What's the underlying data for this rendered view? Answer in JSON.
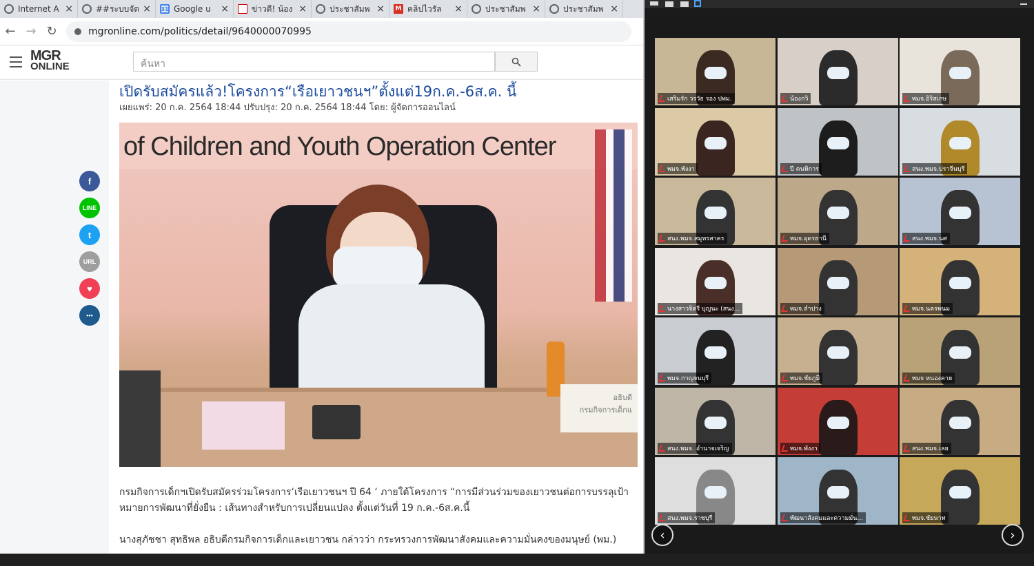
{
  "tabs": [
    {
      "title": "Internet A",
      "icon": "globe-icon"
    },
    {
      "title": "##ระบบจัด",
      "icon": "globe-icon"
    },
    {
      "title": "Google u",
      "icon": "google-calendar-icon"
    },
    {
      "title": "ข่าวดี! น้อง",
      "icon": "news-icon"
    },
    {
      "title": "ประชาสัมพ",
      "icon": "globe-icon"
    },
    {
      "title": "คลิปไวรัล",
      "icon": "mail-icon"
    },
    {
      "title": "ประชาสัมพ",
      "icon": "globe-icon"
    },
    {
      "title": "ประชาสัมพ",
      "icon": "globe-icon"
    }
  ],
  "address": {
    "url": "mgronline.com/politics/detail/9640000070995"
  },
  "site": {
    "logo_top": "MGR",
    "logo_bottom": "ONLINE",
    "search_placeholder": "ค้นหา"
  },
  "article": {
    "title": "เปิดรับสมัครแล้ว!โครงการ“เรือเยาวชนฯ”ตั้งแต่19ก.ค.-6ส.ค. นี้",
    "meta": "เผยแพร่: 20 ก.ค. 2564 18:44   ปรับปรุง: 20 ก.ค. 2564 18:44   โดย: ผู้จัดการออนไลน์",
    "photo_banner": "of Children and Youth Operation Center",
    "photo_nameplate_1": "อธิบดี",
    "photo_nameplate_2": "กรมกิจการเด็กแ",
    "para1": "กรมกิจการเด็กฯเปิดรับสมัครร่วมโครงการ‘เรือเยาวชนฯ ปี 64 ‘ ภายใต้โครงการ “การมีส่วนร่วมของเยาวชนต่อการบรรลุเป้าหมายการพัฒนาที่ยั่งยืน : เส้นทางสำหรับการเปลี่ยนแปลง ตั้งแต่วันที่ 19 ก.ค.-6ส.ค.นี้",
    "para2": "นางสุภัชชา สุทธิพล อธิบดีกรมกิจการเด็กและเยาวชน กล่าวว่า กระทรวงการพัฒนาสังคมและความมั่นคงของมนุษย์ (พม.)"
  },
  "share": [
    {
      "name": "facebook",
      "glyph": "f",
      "color": "#3b5998"
    },
    {
      "name": "line",
      "glyph": "LINE",
      "color": "#00c300"
    },
    {
      "name": "twitter",
      "glyph": "t",
      "color": "#1da1f2"
    },
    {
      "name": "url",
      "glyph": "URL",
      "color": "#9e9e9e"
    },
    {
      "name": "pocket",
      "glyph": "♥",
      "color": "#ef4056"
    },
    {
      "name": "comment",
      "glyph": "•••",
      "color": "#1e5b8c"
    }
  ],
  "zoom": {
    "tiles": [
      {
        "label": "เสริมรัก วรวัธ รอง ปพม.",
        "bg": "#c7b797",
        "fg": "#3b2a22"
      },
      {
        "label": "น้องกวิ",
        "bg": "#d8d0c8",
        "fg": "#2b2b2b"
      },
      {
        "label": "พมจ.อิริสเกษ",
        "bg": "#e8e4dc",
        "fg": "#7a6a5a"
      },
      {
        "label": "พมจ.พังงา",
        "bg": "#dcc9a5",
        "fg": "#3a2520"
      },
      {
        "label": "ปี คนหิการ",
        "bg": "#bfc3c6",
        "fg": "#1d1d1d"
      },
      {
        "label": "สนง.พมจ.ปราจีนบุรี",
        "bg": "#d8dde2",
        "fg": "#b08a2a"
      },
      {
        "label": "สนง.พมจ.สมุทรสาคร",
        "bg": "#c9b89a",
        "fg": "#333"
      },
      {
        "label": "พมจ.อุดรธานี",
        "bg": "#bda88a",
        "fg": "#333"
      },
      {
        "label": "สนง.พมจ.นศ",
        "bg": "#b7c3d3",
        "fg": "#333"
      },
      {
        "label": "นางสาวจิตรี บุญนะ (สนง...",
        "bg": "#e9e5e0",
        "fg": "#4a2e28"
      },
      {
        "label": "พมจ.ลำปาง",
        "bg": "#b69a78",
        "fg": "#333"
      },
      {
        "label": "พมจ.นครพนม",
        "bg": "#d5b27a",
        "fg": "#333"
      },
      {
        "label": "พมจ.กาญจนบุรี",
        "bg": "#c9cdd1",
        "fg": "#222"
      },
      {
        "label": "พมจ.ชัยภูมิ",
        "bg": "#c7b08f",
        "fg": "#333"
      },
      {
        "label": "พมจ หนองคาย",
        "bg": "#b9a277",
        "fg": "#333"
      },
      {
        "label": "สนง.พมจ. อำนาจเจริญ",
        "bg": "#c0b6a8",
        "fg": "#333"
      },
      {
        "label": "พมจ.พังงา",
        "bg": "#c43d36",
        "fg": "#2a1a1a"
      },
      {
        "label": "สนง.พมจ.เลย",
        "bg": "#c7ab82",
        "fg": "#333"
      },
      {
        "label": "สนง.พมจ.ราชบุรี",
        "bg": "#dedede",
        "fg": "#888"
      },
      {
        "label": "พัฒนาสังคมและความมั่น...",
        "bg": "#9fb6c9",
        "fg": "#333"
      },
      {
        "label": "พมจ.ชัยนาท",
        "bg": "#c6a85a",
        "fg": "#333"
      }
    ],
    "prev_glyph": "‹",
    "next_glyph": "›"
  }
}
